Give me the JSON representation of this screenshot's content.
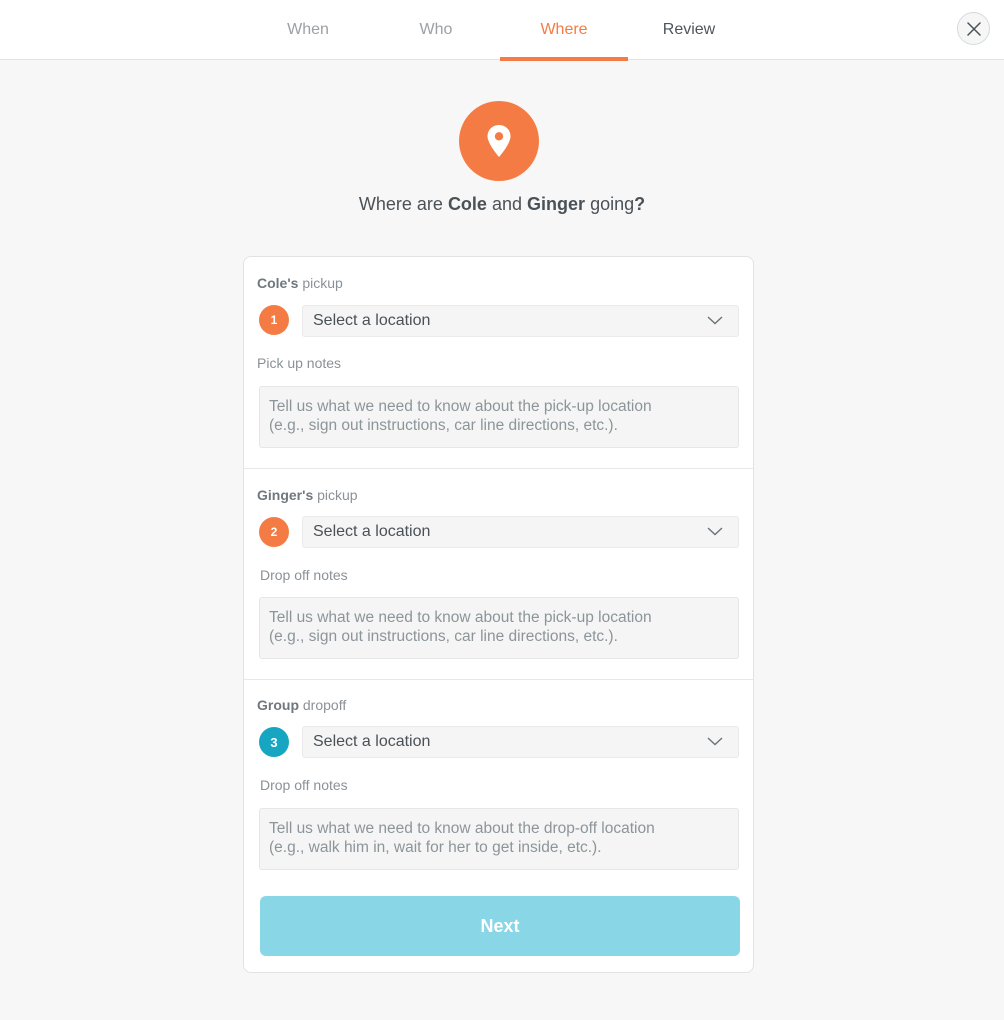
{
  "tabs": [
    {
      "label": "When"
    },
    {
      "label": "Who"
    },
    {
      "label": "Where"
    },
    {
      "label": "Review"
    }
  ],
  "active_tab": "Where",
  "headline": {
    "prefix": "Where are",
    "name1": "Cole",
    "and": "and",
    "name2": "Ginger",
    "suffix": "going",
    "question_mark": "?"
  },
  "sections": [
    {
      "label_bold": "Cole's",
      "label_rest": "pickup",
      "number": "1",
      "select_value": "Select a location",
      "notes_label": "Pick up notes",
      "notes_placeholder": "Tell us what we need to know about the pick-up location\n(e.g., sign out instructions, car line directions, etc.)."
    },
    {
      "label_bold": "Ginger's",
      "label_rest": "pickup",
      "number": "2",
      "select_value": "Select a location",
      "notes_label": "Drop off notes",
      "notes_placeholder": "Tell us what we need to know about the pick-up location\n(e.g., sign out instructions, car line directions, etc.)."
    },
    {
      "label_bold": "Group",
      "label_rest": "dropoff",
      "number": "3",
      "select_value": "Select a location",
      "notes_label": "Drop off notes",
      "notes_placeholder": "Tell us what we need to know about the drop-off location\n(e.g., walk him in, wait for her to get inside, etc.)."
    }
  ],
  "next_button": "Next",
  "colors": {
    "accent": "#f47c44",
    "teal": "#16a6c1",
    "next_disabled": "#82d4e5"
  },
  "icons": {
    "close": "close-icon",
    "hero": "map-pin-icon",
    "dropdown": "chevron-down-icon"
  }
}
